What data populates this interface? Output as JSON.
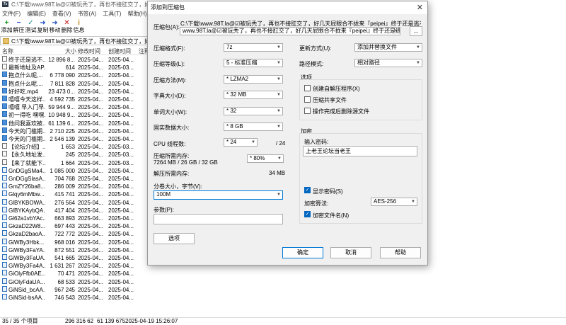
{
  "window": {
    "title": "C:\\下载\\www.98T.la@☑被玩秃了，再也不接肛交了，好几天屁..."
  },
  "menu": [
    "文件(F)",
    "编辑(E)",
    "查看(V)",
    "书签(A)",
    "工具(T)",
    "帮助(H)"
  ],
  "toolbar": [
    {
      "label": "添加",
      "icon": "plus-icon",
      "glyph": "+",
      "color": "#1a9b1a"
    },
    {
      "label": "解压",
      "icon": "minus-icon",
      "glyph": "−",
      "color": "#1f4fbf"
    },
    {
      "label": "测试",
      "icon": "check-icon",
      "glyph": "✓",
      "color": "#1f9090"
    },
    {
      "label": "复制",
      "icon": "copy-arrow-icon",
      "glyph": "➜",
      "color": "#1f4fbf"
    },
    {
      "label": "移动",
      "icon": "move-arrow-icon",
      "glyph": "➜",
      "color": "#1f4fbf"
    },
    {
      "label": "删除",
      "icon": "delete-icon",
      "glyph": "✕",
      "color": "#c01818"
    },
    {
      "label": "信息",
      "icon": "info-icon",
      "glyph": "i",
      "color": "#c08a18"
    }
  ],
  "address": "C:\\下载\\www.98T.la@☑被玩秃了，再也不接肛交了，好几天屁...",
  "columns": {
    "name": "名称",
    "size": "大小",
    "modified": "修改时间",
    "created": "创建时间",
    "comment": "注释"
  },
  "files": [
    {
      "name": "终于还是逃不...",
      "size": "12 896 8...",
      "modified": "2025-04...",
      "created": "2025-04...",
      "icon": "folder-icon",
      "type": "f"
    },
    {
      "name": "最新地址及AP...",
      "size": "614",
      "modified": "2025-04...",
      "created": "2025-03...",
      "icon": "text-file-icon",
      "type": "f"
    },
    {
      "name": "抱点什么呢,...",
      "size": "6 778 090",
      "modified": "2025-04...",
      "created": "2025-04...",
      "icon": "video-file-icon",
      "type": "v"
    },
    {
      "name": "抱点什么呢,...",
      "size": "7 811 828",
      "modified": "2025-04...",
      "created": "2025-04...",
      "icon": "video-file-icon",
      "type": "v"
    },
    {
      "name": "好好吃.mp4",
      "size": "23 473 0...",
      "modified": "2025-04...",
      "created": "2025-04...",
      "icon": "video-file-icon",
      "type": "v"
    },
    {
      "name": "嘻嘻今天这样...",
      "size": "4 592 735",
      "modified": "2025-04...",
      "created": "2025-04...",
      "icon": "video-file-icon",
      "type": "v"
    },
    {
      "name": "嘻嘻 早入门早...",
      "size": "59 944 9...",
      "modified": "2025-04...",
      "created": "2025-04...",
      "icon": "video-file-icon",
      "type": "v"
    },
    {
      "name": "初一得吃 嘿嘿...",
      "size": "10 948 9...",
      "modified": "2025-04...",
      "created": "2025-04...",
      "icon": "video-file-icon",
      "type": "v"
    },
    {
      "name": "他问我喜欢被...",
      "size": "61 139 6...",
      "modified": "2025-04...",
      "created": "2025-04...",
      "icon": "video-file-icon",
      "type": "v"
    },
    {
      "name": "今天的门槛期...",
      "size": "2 710 225",
      "modified": "2025-04...",
      "created": "2025-04...",
      "icon": "video-file-icon",
      "type": "v"
    },
    {
      "name": "今天的门槛期...",
      "size": "2 546 139",
      "modified": "2025-04...",
      "created": "2025-04...",
      "icon": "video-file-icon",
      "type": "v"
    },
    {
      "name": "【论坛介绍】...",
      "size": "1 653",
      "modified": "2025-04...",
      "created": "2025-03...",
      "icon": "text-file-icon",
      "type": "f"
    },
    {
      "name": "【永久地址发...",
      "size": "245",
      "modified": "2025-04...",
      "created": "2025-03...",
      "icon": "text-file-icon",
      "type": "f"
    },
    {
      "name": "【来了就能下...",
      "size": "1 664",
      "modified": "2025-04...",
      "created": "2025-03...",
      "icon": "text-file-icon",
      "type": "f"
    },
    {
      "name": "GnDGgSMa4...",
      "size": "1 085 000",
      "modified": "2025-04...",
      "created": "2025-04...",
      "icon": "image-file-icon",
      "type": "h"
    },
    {
      "name": "GnDGgSlasA...",
      "size": "704 768",
      "modified": "2025-04...",
      "created": "2025-04...",
      "icon": "image-file-icon",
      "type": "h"
    },
    {
      "name": "GmZY26ba8...",
      "size": "286 009",
      "modified": "2025-04...",
      "created": "2025-04...",
      "icon": "image-file-icon",
      "type": "h"
    },
    {
      "name": "Glqy6mMbw...",
      "size": "415 741",
      "modified": "2025-04...",
      "created": "2025-04...",
      "icon": "image-file-icon",
      "type": "h"
    },
    {
      "name": "GlBYKBOWA...",
      "size": "276 564",
      "modified": "2025-04...",
      "created": "2025-04...",
      "icon": "image-file-icon",
      "type": "h"
    },
    {
      "name": "GlBYKAybQA...",
      "size": "417 404",
      "modified": "2025-04...",
      "created": "2025-04...",
      "icon": "image-file-icon",
      "type": "h"
    },
    {
      "name": "Gl62a1vbYAc...",
      "size": "663 893",
      "modified": "2025-04...",
      "created": "2025-04...",
      "icon": "image-file-icon",
      "type": "h"
    },
    {
      "name": "GkzaD22W8...",
      "size": "697 443",
      "modified": "2025-04...",
      "created": "2025-04...",
      "icon": "image-file-icon",
      "type": "h"
    },
    {
      "name": "GkzaD2baoA...",
      "size": "722 772",
      "modified": "2025-04...",
      "created": "2025-04...",
      "icon": "image-file-icon",
      "type": "h"
    },
    {
      "name": "GiWBy3Hbk...",
      "size": "968 016",
      "modified": "2025-04...",
      "created": "2025-04...",
      "icon": "image-file-icon",
      "type": "h"
    },
    {
      "name": "GiWBy3FaYA...",
      "size": "872 551",
      "modified": "2025-04...",
      "created": "2025-04...",
      "icon": "image-file-icon",
      "type": "h"
    },
    {
      "name": "GiWBy3FaUA...",
      "size": "541 665",
      "modified": "2025-04...",
      "created": "2025-04...",
      "icon": "image-file-icon",
      "type": "h"
    },
    {
      "name": "GiWBy3Fa4A...",
      "size": "1 631 267",
      "modified": "2025-04...",
      "created": "2025-04...",
      "icon": "image-file-icon",
      "type": "h"
    },
    {
      "name": "GiOlyFfb0AE...",
      "size": "70 471",
      "modified": "2025-04...",
      "created": "2025-04...",
      "icon": "image-file-icon",
      "type": "h"
    },
    {
      "name": "GiOlyFdaUA...",
      "size": "68 533",
      "modified": "2025-04...",
      "created": "2025-04...",
      "icon": "image-file-icon",
      "type": "h"
    },
    {
      "name": "GiNSid_bcAA...",
      "size": "967 245",
      "modified": "2025-04...",
      "created": "2025-04...",
      "icon": "image-file-icon",
      "type": "h"
    },
    {
      "name": "GiNSid-bsAA...",
      "size": "746 543",
      "modified": "2025-04...",
      "created": "2025-04...",
      "icon": "image-file-icon",
      "type": "h"
    }
  ],
  "status": {
    "count": "35 / 35 个项目",
    "total": "296 316 62",
    "size2": "61 139 675",
    "datetime": "2025-04-19 15:26:07"
  },
  "dialog": {
    "title": "添加到压缩包",
    "archive_label": "压缩包(A):",
    "archive_dir": "C:\\下载\\www.98T.la@☑被玩秃了，再也不接肛交了，好几天屁眼合不拢来『peipei』终于还是逃不过这一天。欢迎",
    "archive_name": "www.98T.la@☑被玩秃了，再也不接肛交了，好几天屁眼合不拢来『peipei』终于还是逃不过这一天。",
    "browse": "...",
    "format_label": "压缩格式(F):",
    "format_value": "7z",
    "level_label": "压缩等级(L):",
    "level_value": "5 - 标准压缩",
    "method_label": "压缩方法(M):",
    "method_value": "* LZMA2",
    "dict_label": "字典大小(D):",
    "dict_value": "* 32 MB",
    "word_label": "单词大小(W):",
    "word_value": "* 32",
    "solid_label": "固实数据大小:",
    "solid_value": "* 8 GB",
    "cpu_label": "CPU 线程数:",
    "cpu_value": "* 24",
    "cpu_total": "/ 24",
    "memc_label": "压缩所需内存:",
    "memc_detail": "7264 MB / 26 GB / 32 GB",
    "memc_value": "* 80%",
    "memd_label": "解压所需内存:",
    "memd_value": "34 MB",
    "split_label": "分卷大小，字节(V):",
    "split_value": "100M",
    "param_label": "参数(P):",
    "param_value": "",
    "options_button": "选项",
    "update_label": "更新方式(U):",
    "update_value": "添加并替换文件",
    "path_label": "路径模式:",
    "path_value": "相对路径",
    "options_group": "选项",
    "opt_sfx": "创建自解压程序(X)",
    "opt_shared": "压缩共享文件",
    "opt_delete": "操作完成后删除源文件",
    "enc_group": "加密",
    "pwd_label": "输入密码:",
    "pwd_value": "上老王论坛当老王",
    "show_pwd": "显示密码(S)",
    "enc_method_label": "加密算法:",
    "enc_method_value": "AES-256",
    "enc_names": "加密文件名(N)",
    "ok": "确定",
    "cancel": "取消",
    "help": "帮助"
  }
}
